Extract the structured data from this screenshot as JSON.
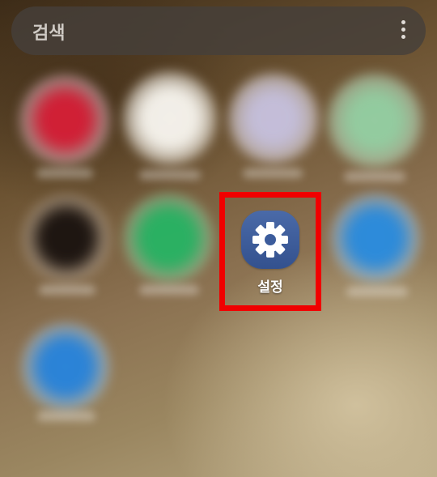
{
  "search": {
    "label": "검색",
    "more_icon": "more-vertical-icon"
  },
  "apps": [
    {
      "name": "blurred-app-1",
      "color": "#d2243a"
    },
    {
      "name": "blurred-app-2",
      "color": "#f2f0ea"
    },
    {
      "name": "blurred-app-3",
      "color": "#cfcadf"
    },
    {
      "name": "blurred-app-4",
      "color": "#9fd9b0"
    },
    {
      "name": "blurred-app-5",
      "color": "#1a1412"
    },
    {
      "name": "blurred-app-6",
      "color": "#27b76a"
    },
    {
      "name": "blurred-app-8",
      "color": "#2f8fe0"
    },
    {
      "name": "blurred-app-9",
      "color": "#2a86de"
    }
  ],
  "settings_app": {
    "label": "설정",
    "icon": "gear-icon",
    "icon_bg": "#3c5c9c"
  },
  "highlight": {
    "color": "#f00000"
  }
}
